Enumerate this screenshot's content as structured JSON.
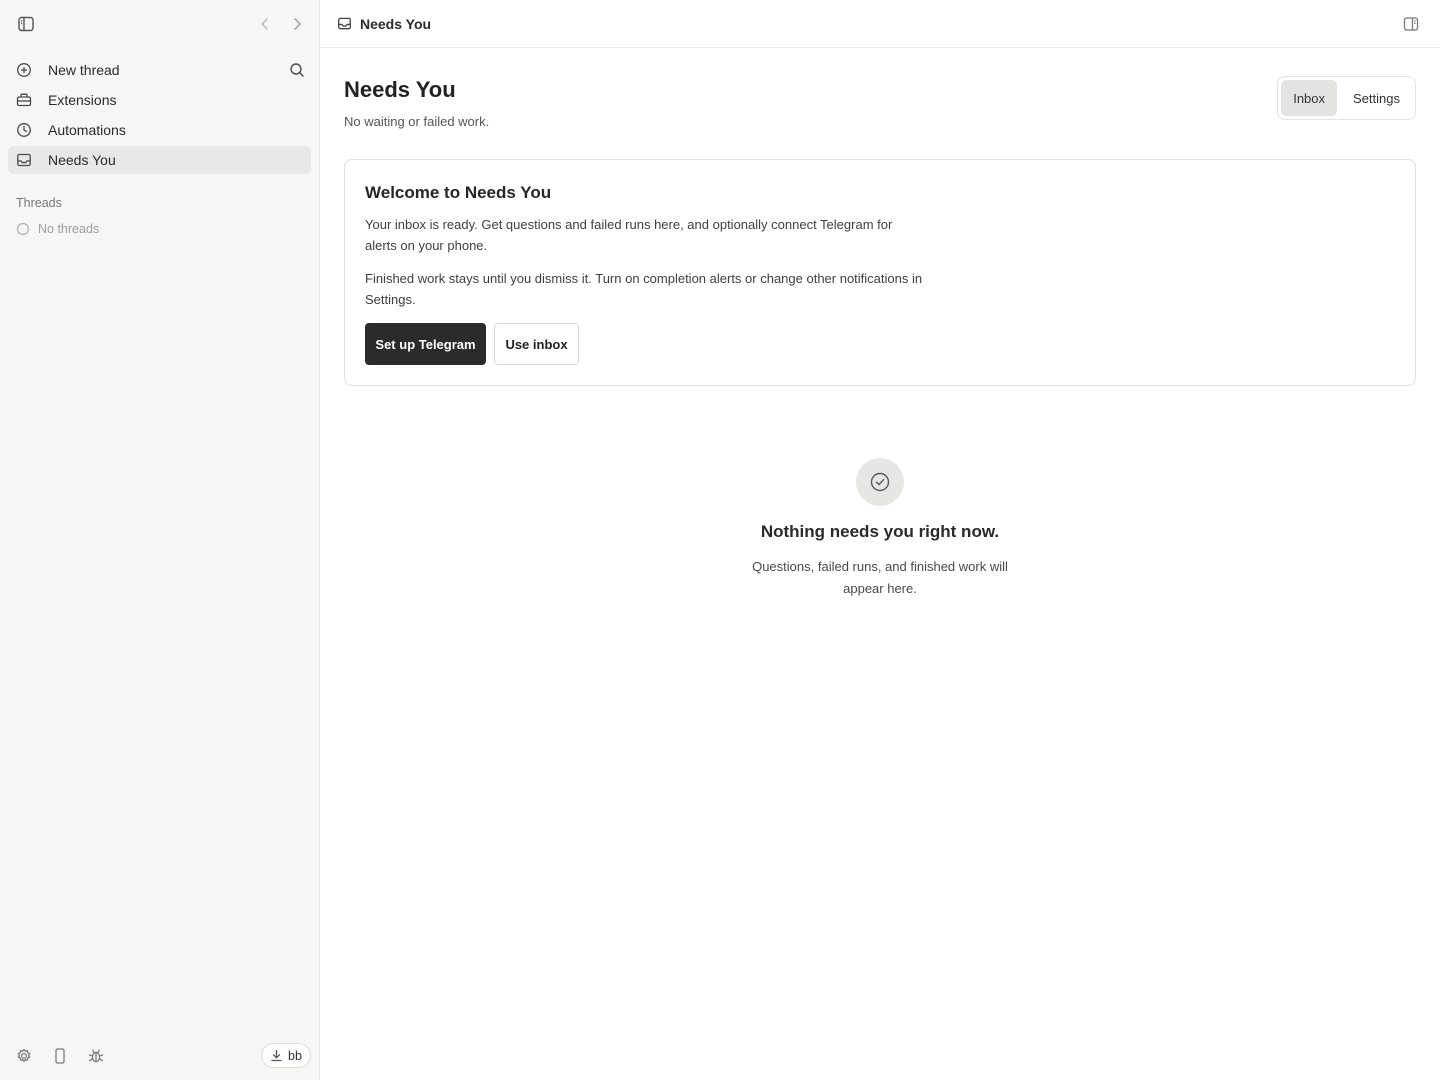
{
  "sidebar": {
    "nav": [
      {
        "label": "New thread",
        "icon": "plus-circle-icon"
      },
      {
        "label": "Extensions",
        "icon": "extensions-icon"
      },
      {
        "label": "Automations",
        "icon": "clock-icon"
      },
      {
        "label": "Needs You",
        "icon": "inbox-icon",
        "active": true
      }
    ],
    "threads_heading": "Threads",
    "no_threads": "No threads",
    "user_label": "bb"
  },
  "header": {
    "title": "Needs You"
  },
  "page": {
    "title": "Needs You",
    "subtitle": "No waiting or failed work.",
    "tabs": [
      {
        "label": "Inbox",
        "active": true
      },
      {
        "label": "Settings",
        "active": false
      }
    ]
  },
  "welcome": {
    "title": "Welcome to Needs You",
    "paragraph1": "Your inbox is ready. Get questions and failed runs here, and optionally connect Telegram for alerts on your phone.",
    "paragraph2": "Finished work stays until you dismiss it. Turn on completion alerts or change other notifications in Settings.",
    "primary_button": "Set up Telegram",
    "secondary_button": "Use inbox"
  },
  "empty_state": {
    "title": "Nothing needs you right now.",
    "subtitle": "Questions, failed runs, and finished work will appear here."
  },
  "colors": {
    "sidebar_bg": "#f6f6f5",
    "active_item_bg": "#e8e8e6",
    "primary_button_bg": "#2b2b2b"
  }
}
